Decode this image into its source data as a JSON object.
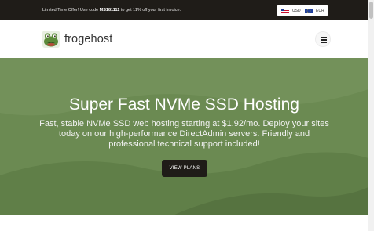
{
  "promo": {
    "text_before": "Limited Time Offer! Use code ",
    "code": "MS181111",
    "text_after": " to get 11% off your first invoice."
  },
  "currency": {
    "options": [
      {
        "label": "USD",
        "icon": "us-flag-icon"
      },
      {
        "label": "EUR",
        "icon": "eu-flag-icon"
      }
    ]
  },
  "nav": {
    "logo_text": "frogehost",
    "menu_icon": "hamburger-menu-icon"
  },
  "hero": {
    "title": "Super Fast NVMe SSD Hosting",
    "subtitle": "Fast, stable NVMe SSD web hosting starting at $1.92/mo. Deploy your sites today on our high-performance DirectAdmin servers. Friendly and professional technical support included!",
    "cta_label": "VIEW PLANS"
  },
  "colors": {
    "topbar": "#1f1c18",
    "hero_green": "#6b8a52",
    "hero_green_dark": "#5d7a46",
    "button": "#1f1c18"
  }
}
